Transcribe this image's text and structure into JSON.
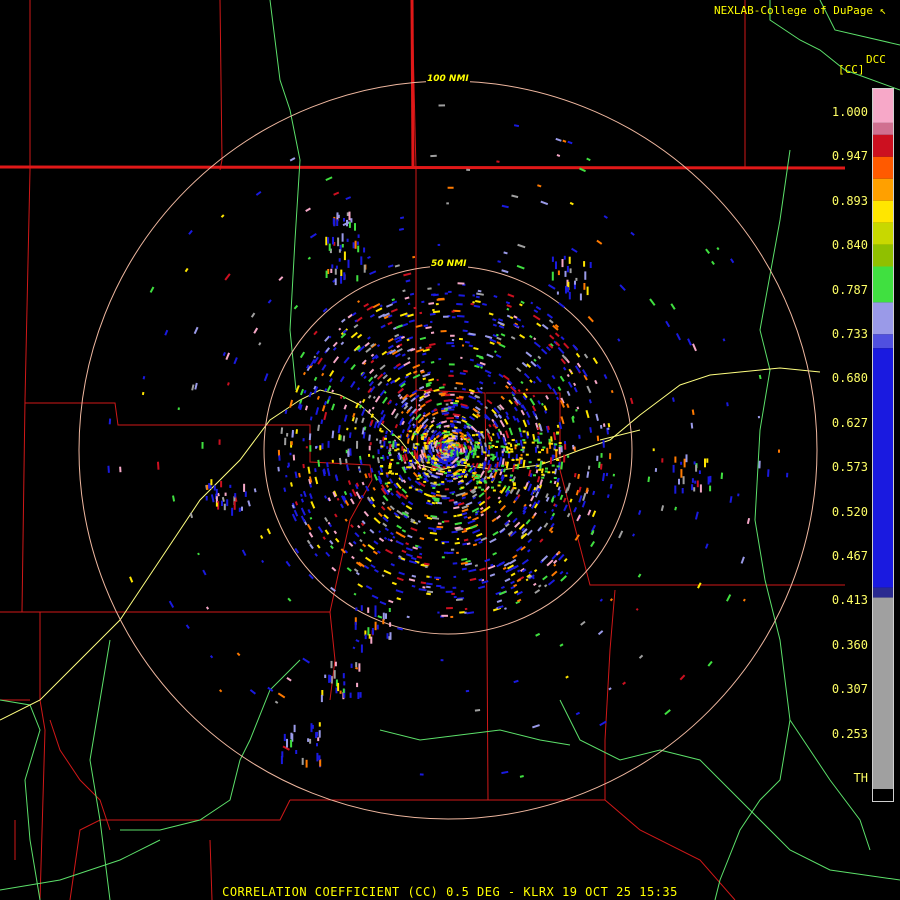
{
  "header": {
    "credit": "NEXLAB-College of DuPage",
    "credit_icon": "cursor-arrow-icon",
    "product_code": "DCC",
    "unit": "[CC]"
  },
  "footer": {
    "caption": "CORRELATION COEFFICIENT (CC) 0.5 DEG - KLRX 19 OCT 25 15:35"
  },
  "range_rings": [
    {
      "label": "50 NMI",
      "nmi": 50
    },
    {
      "label": "100 NMI",
      "nmi": 100
    }
  ],
  "color_scale": {
    "ticks": [
      "1.000",
      "0.947",
      "0.893",
      "0.840",
      "0.787",
      "0.733",
      "0.680",
      "0.627",
      "0.573",
      "0.520",
      "0.467",
      "0.413",
      "0.360",
      "0.307",
      "0.253",
      "TH"
    ],
    "colors": {
      "pink": "#f7a8c8",
      "red": "#cc1020",
      "orange": "#ff7a00",
      "yellow": "#ffe600",
      "green": "#40e040",
      "lavender": "#9a9ae8",
      "blue": "#1a1ae0",
      "gray": "#a0a0a0",
      "boundary_red": "#d01818",
      "road_green": "#5ce06a",
      "highway_yellow": "#ffff80",
      "ring": "#f0b8a0"
    }
  }
}
